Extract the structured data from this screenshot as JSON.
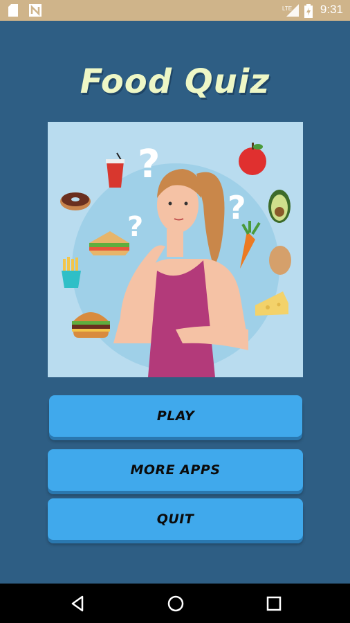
{
  "status_bar": {
    "time": "9:31",
    "icons": [
      "sd-card-icon",
      "notification-n-icon",
      "lte-signal-icon",
      "battery-charging-icon"
    ]
  },
  "app": {
    "title": "Food Quiz"
  },
  "buttons": {
    "play": "PLAY",
    "more_apps": "MORE APPS",
    "quit": "QUIT"
  },
  "nav_bar": {
    "icons": [
      "back-icon",
      "home-icon",
      "recents-icon"
    ]
  },
  "colors": {
    "background": "#2e5e84",
    "status_bar": "#cfb48a",
    "title": "#eef7c6",
    "button": "#40a9ec",
    "button_text": "#0b0b0b",
    "illustration_bg": "#b9dcef"
  }
}
